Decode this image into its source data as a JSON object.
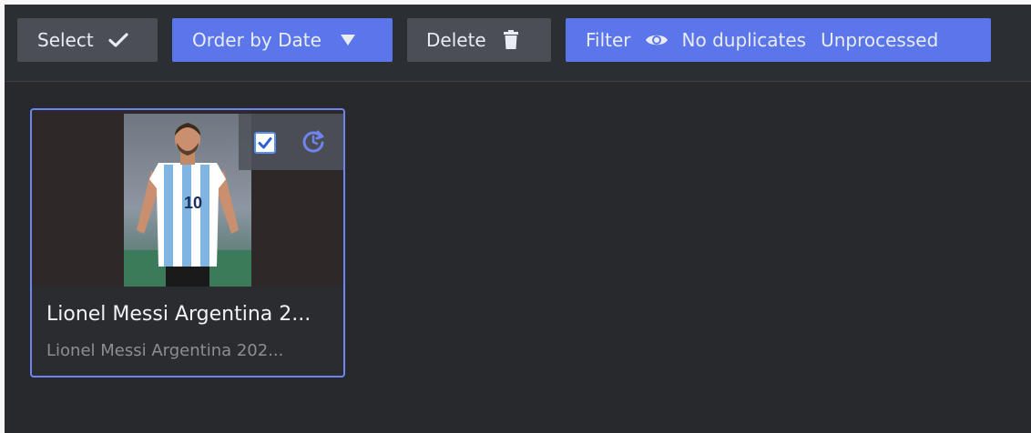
{
  "toolbar": {
    "select_label": "Select",
    "order_label": "Order by Date",
    "delete_label": "Delete",
    "filter_label": "Filter",
    "filter_tags": [
      "No duplicates",
      "Unprocessed"
    ]
  },
  "colors": {
    "accent": "#5b76ea",
    "button_grey": "#4b4f55",
    "background": "#27292d",
    "selection_border": "#6d86f2"
  },
  "icons": {
    "select": "checkmark-icon",
    "order": "triangle-down-icon",
    "delete": "trash-icon",
    "filter": "eye-icon",
    "card_check": "checkbox-checked-icon",
    "card_action": "refresh-icon"
  },
  "gallery": {
    "items": [
      {
        "title": "Lionel Messi Argentina 2...",
        "subtitle": "Lionel Messi Argentina 202...",
        "selected": true,
        "checked": true
      }
    ]
  }
}
